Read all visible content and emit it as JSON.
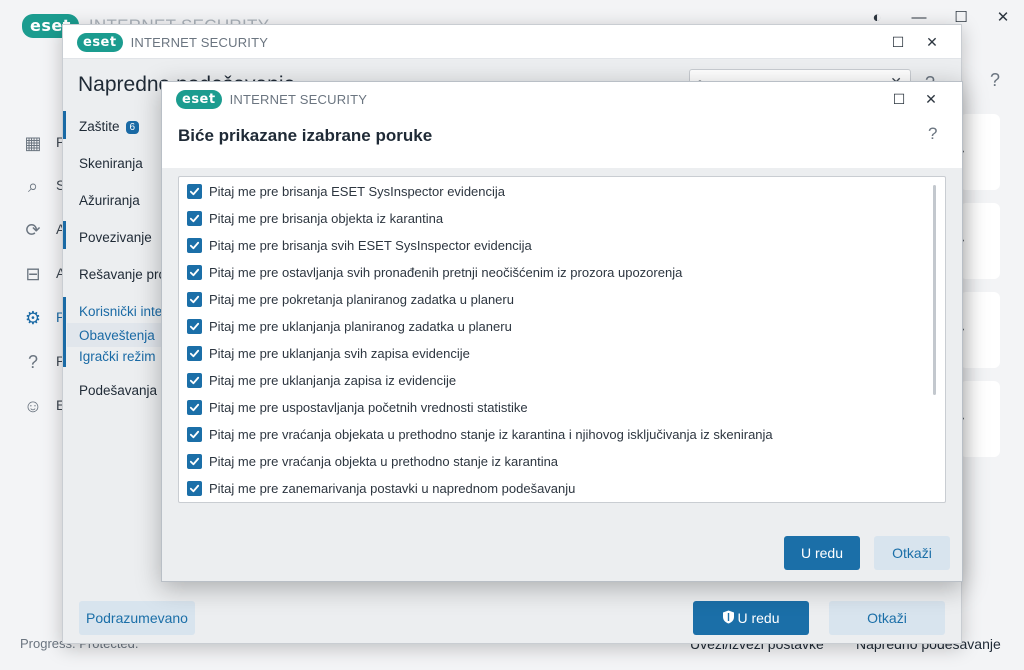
{
  "main": {
    "logo_text": "eset",
    "product": "INTERNET SECURITY",
    "nav_letters": [
      "P",
      "S",
      "A",
      "A",
      "P",
      "P",
      "E"
    ],
    "nav_icons": [
      "dashboard-icon",
      "search-icon",
      "refresh-icon",
      "briefcase-icon",
      "gear-icon",
      "help-circle-icon",
      "user-account-icon"
    ],
    "status": "Progress. Protected.",
    "bottom_links": [
      "Uvezi/izvezi postavke",
      "Napredno podešavanje"
    ],
    "help": "?"
  },
  "advanced": {
    "logo_text": "eset",
    "product": "INTERNET SECURITY",
    "title": "Napredno podešavanje",
    "search_placeholder": "",
    "help": "?",
    "nav": {
      "zastite": "Zaštite",
      "zastite_badge": "6",
      "skeniranja": "Skeniranja",
      "azuriranja": "Ažuriranja",
      "povezivanje": "Povezivanje",
      "resavanje": "Rešavanje problema",
      "korisnicki": "Korisnički interfejs",
      "obavestenja": "Obaveštenja",
      "igracki": "Igrački režim",
      "podesavanja": "Podešavanja privatnosti"
    },
    "buttons": {
      "default": "Podrazumevano",
      "ok": "U redu",
      "cancel": "Otkaži"
    }
  },
  "dialog": {
    "logo_text": "eset",
    "product": "INTERNET SECURITY",
    "title": "Biće prikazane izabrane poruke",
    "help": "?",
    "items": [
      {
        "label": "Pitaj me pre brisanja ESET SysInspector evidencija",
        "checked": true
      },
      {
        "label": "Pitaj me pre brisanja objekta iz karantina",
        "checked": true
      },
      {
        "label": "Pitaj me pre brisanja svih ESET SysInspector evidencija",
        "checked": true
      },
      {
        "label": "Pitaj me pre ostavljanja svih pronađenih pretnji neočišćenim iz prozora upozorenja",
        "checked": true
      },
      {
        "label": "Pitaj me pre pokretanja planiranog zadatka u planeru",
        "checked": true
      },
      {
        "label": "Pitaj me pre uklanjanja planiranog zadatka u planeru",
        "checked": true
      },
      {
        "label": "Pitaj me pre uklanjanja svih zapisa evidencije",
        "checked": true
      },
      {
        "label": "Pitaj me pre uklanjanja zapisa iz evidencije",
        "checked": true
      },
      {
        "label": "Pitaj me pre uspostavljanja početnih vrednosti statistike",
        "checked": true
      },
      {
        "label": "Pitaj me pre vraćanja objekata u prethodno stanje iz karantina i njihovog isključivanja iz skeniranja",
        "checked": true
      },
      {
        "label": "Pitaj me pre vraćanja objekta u prethodno stanje iz karantina",
        "checked": true
      },
      {
        "label": "Pitaj me pre zanemarivanja postavki u naprednom podešavanju",
        "checked": true
      }
    ],
    "buttons": {
      "ok": "U redu",
      "cancel": "Otkaži"
    }
  }
}
